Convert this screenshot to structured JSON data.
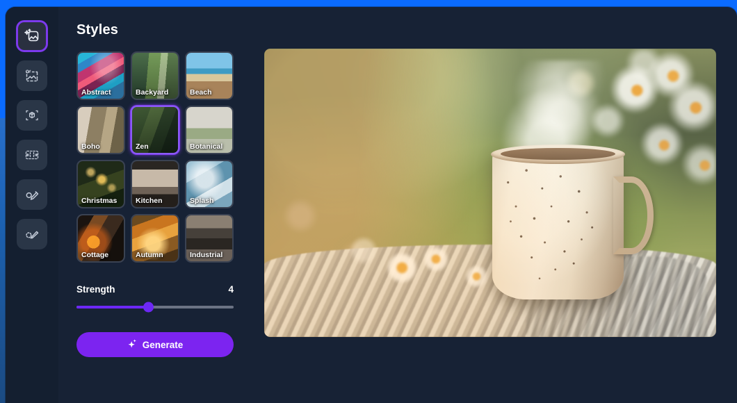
{
  "window": {
    "accent_blue": "#0b6dff",
    "panel_bg": "#172235",
    "rail_bg": "#141f30",
    "accent_purple": "#7c3aed"
  },
  "tool_rail": {
    "items": [
      {
        "name": "generate-image-tool",
        "icon": "image-sparkle-icon",
        "active": true
      },
      {
        "name": "text-to-image-tool",
        "icon": "image-dashed-text-icon",
        "active": false
      },
      {
        "name": "three-d-tool",
        "icon": "cube-frame-icon",
        "active": false
      },
      {
        "name": "expand-canvas-tool",
        "icon": "expand-arrows-icon",
        "active": false
      },
      {
        "name": "object-edit-tool",
        "icon": "circle-pen-icon",
        "active": false
      },
      {
        "name": "brush-select-tool",
        "icon": "dashed-circle-brush-icon",
        "active": false
      }
    ]
  },
  "styles_panel": {
    "title": "Styles",
    "selected_style": "Zen",
    "cards": [
      {
        "label": "Abstract",
        "thumb_class": "t-abstract",
        "selected": false
      },
      {
        "label": "Backyard",
        "thumb_class": "t-backyard",
        "selected": false
      },
      {
        "label": "Beach",
        "thumb_class": "t-beach",
        "selected": false
      },
      {
        "label": "Boho",
        "thumb_class": "t-boho",
        "selected": false
      },
      {
        "label": "Zen",
        "thumb_class": "t-zen",
        "selected": true
      },
      {
        "label": "Botanical",
        "thumb_class": "t-botanical",
        "selected": false
      },
      {
        "label": "Christmas",
        "thumb_class": "t-christmas",
        "selected": false
      },
      {
        "label": "Kitchen",
        "thumb_class": "t-kitchen",
        "selected": false
      },
      {
        "label": "Splash",
        "thumb_class": "t-splash",
        "selected": false
      },
      {
        "label": "Cottage",
        "thumb_class": "t-cottage",
        "selected": false
      },
      {
        "label": "Autumn",
        "thumb_class": "t-autumn",
        "selected": false
      },
      {
        "label": "Industrial",
        "thumb_class": "t-industrial",
        "selected": false
      }
    ]
  },
  "strength": {
    "label": "Strength",
    "value": "4",
    "percent": 46,
    "min": 0,
    "max": 10
  },
  "generate": {
    "label": "Generate",
    "icon": "sparkle-icon"
  },
  "preview": {
    "alt": "Speckled ceramic mug of steaming coffee on a knitted blanket among daisies in a sunlit garden"
  }
}
